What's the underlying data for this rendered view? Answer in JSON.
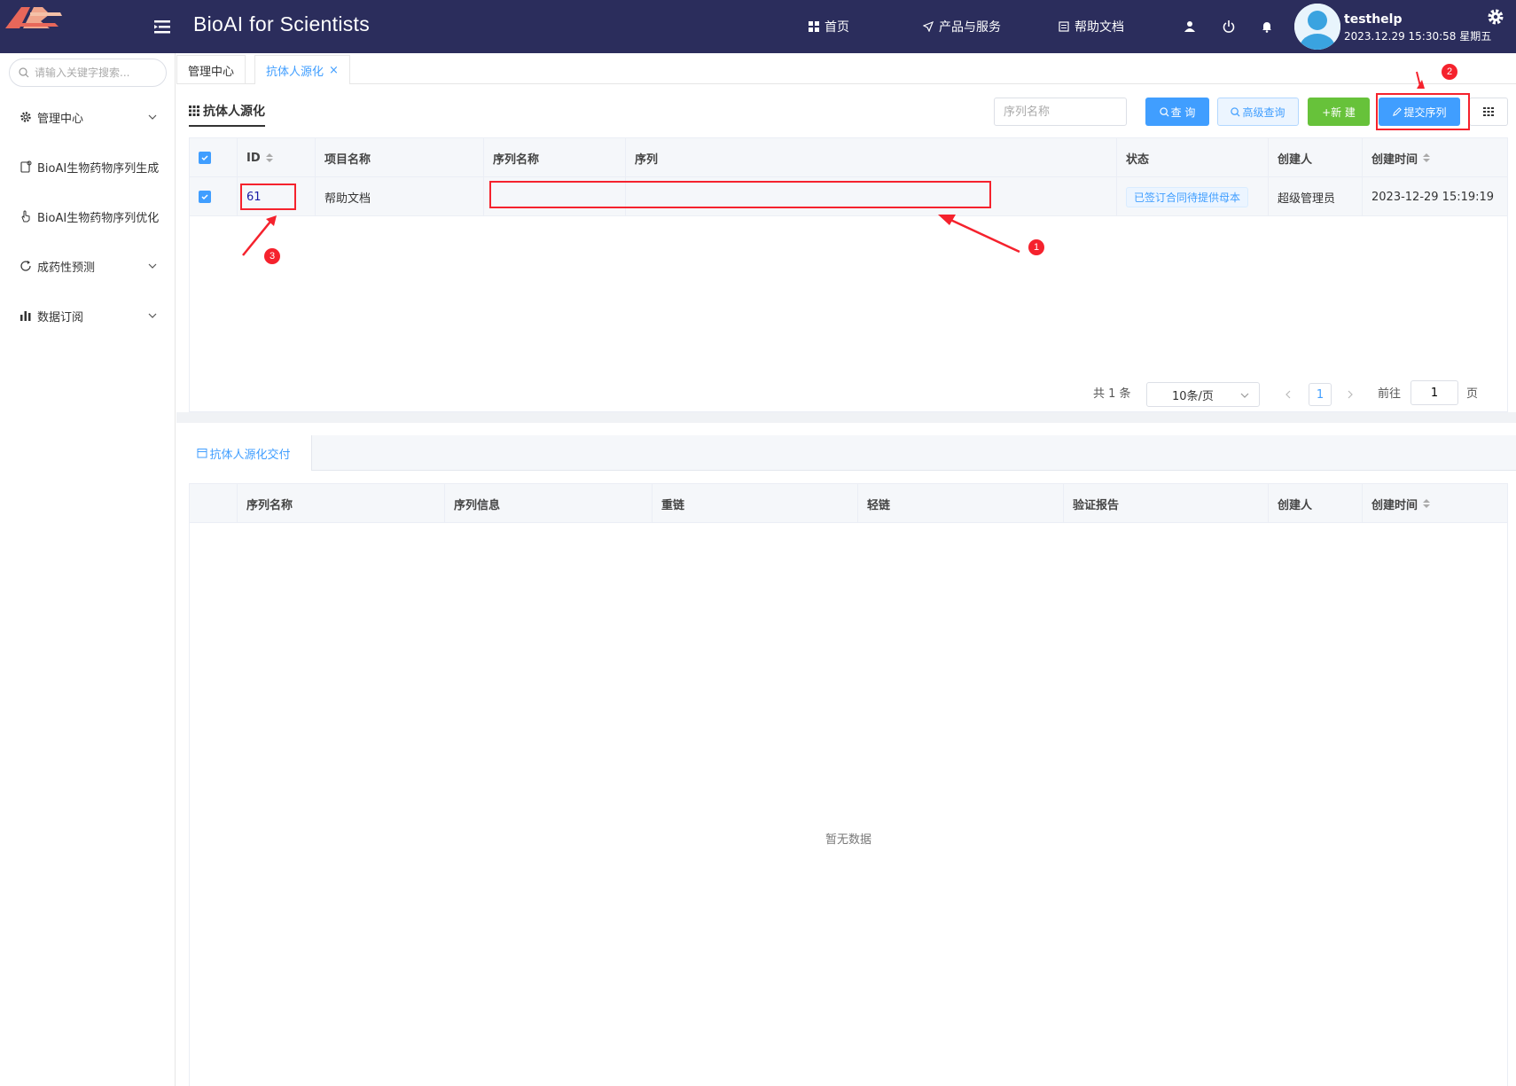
{
  "header": {
    "title": "BioAI for Scientists",
    "nav": [
      "首页",
      "产品与服务",
      "帮助文档"
    ],
    "username": "testhelp",
    "datetime": "2023.12.29 15:30:58 星期五"
  },
  "sidebar": {
    "search_placeholder": "请输入关键字搜索...",
    "items": [
      {
        "label": "管理中心",
        "icon": "gear-icon",
        "expandable": true
      },
      {
        "label": "BioAI生物药物序列生成",
        "icon": "clipboard-icon",
        "expandable": false
      },
      {
        "label": "BioAI生物药物序列优化",
        "icon": "hand-pointer-icon",
        "expandable": false
      },
      {
        "label": "成药性预测",
        "icon": "refresh-icon",
        "expandable": true
      },
      {
        "label": "数据订阅",
        "icon": "bar-chart-icon",
        "expandable": true
      }
    ]
  },
  "tabs": [
    {
      "label": "管理中心",
      "active": false
    },
    {
      "label": "抗体人源化",
      "active": true,
      "close": "×"
    }
  ],
  "main": {
    "title": "抗体人源化",
    "search_placeholder": "序列名称",
    "buttons": {
      "query": "查 询",
      "advanced": "高级查询",
      "new": "+新 建",
      "submit": "提交序列"
    },
    "table": {
      "columns": [
        "ID",
        "项目名称",
        "序列名称",
        "序列",
        "状态",
        "创建人",
        "创建时间"
      ],
      "rows": [
        {
          "id": "61",
          "project": "帮助文档",
          "seq_name": "",
          "sequence": "",
          "status": "已签订合同待提供母本",
          "creator": "超级管理员",
          "created": "2023-12-29 15:19:19"
        }
      ]
    },
    "pagination": {
      "total": "共 1 条",
      "page_size": "10条/页",
      "current": "1",
      "goto_label": "前往",
      "goto_value": "1",
      "page_suffix": "页"
    }
  },
  "lower": {
    "tab_label": "抗体人源化交付",
    "columns": [
      "序列名称",
      "序列信息",
      "重链",
      "轻链",
      "验证报告",
      "创建人",
      "创建时间"
    ],
    "empty_text": "暂无数据"
  },
  "annotations": {
    "badge1": "1",
    "badge2": "2",
    "badge3": "3",
    "color": "#f5222d"
  },
  "colors": {
    "header_bg": "#2b2d5c",
    "primary": "#409eff",
    "success": "#67c23a"
  }
}
